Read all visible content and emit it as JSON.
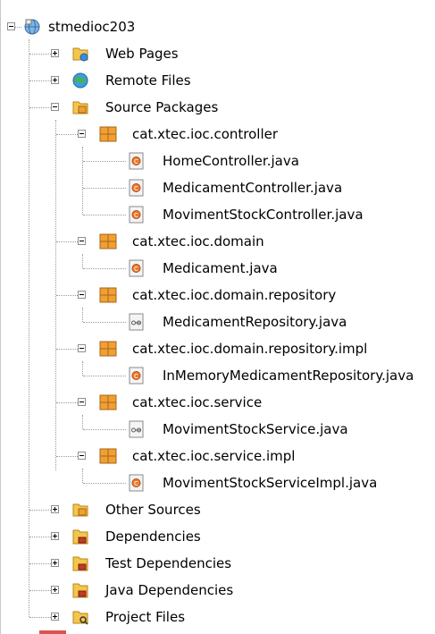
{
  "tree": {
    "root": {
      "label": "stmedioc203",
      "icon": "globe-project-icon",
      "expanded": true
    },
    "nodes": [
      {
        "label": "Web Pages",
        "icon": "web-pages-folder-icon",
        "expanded": false
      },
      {
        "label": "Remote Files",
        "icon": "remote-files-globe-icon",
        "expanded": false
      },
      {
        "label": "Source Packages",
        "icon": "source-folder-icon",
        "expanded": true
      },
      {
        "label": "cat.xtec.ioc.controller",
        "icon": "package-icon",
        "expanded": true
      },
      {
        "label": "HomeController.java",
        "icon": "java-class-icon"
      },
      {
        "label": "MedicamentController.java",
        "icon": "java-class-icon"
      },
      {
        "label": "MovimentStockController.java",
        "icon": "java-class-icon"
      },
      {
        "label": "cat.xtec.ioc.domain",
        "icon": "package-icon",
        "expanded": true
      },
      {
        "label": "Medicament.java",
        "icon": "java-class-icon"
      },
      {
        "label": "cat.xtec.ioc.domain.repository",
        "icon": "package-icon",
        "expanded": true
      },
      {
        "label": "MedicamentRepository.java",
        "icon": "java-interface-icon"
      },
      {
        "label": "cat.xtec.ioc.domain.repository.impl",
        "icon": "package-icon",
        "expanded": true
      },
      {
        "label": "InMemoryMedicamentRepository.java",
        "icon": "java-class-icon"
      },
      {
        "label": "cat.xtec.ioc.service",
        "icon": "package-icon",
        "expanded": true
      },
      {
        "label": "MovimentStockService.java",
        "icon": "java-interface-icon"
      },
      {
        "label": "cat.xtec.ioc.service.impl",
        "icon": "package-icon",
        "expanded": true
      },
      {
        "label": "MovimentStockServiceImpl.java",
        "icon": "java-class-icon"
      },
      {
        "label": "Other Sources",
        "icon": "other-sources-folder-icon",
        "expanded": false
      },
      {
        "label": "Dependencies",
        "icon": "dependencies-folder-icon",
        "expanded": false
      },
      {
        "label": "Test Dependencies",
        "icon": "dependencies-folder-icon",
        "expanded": false
      },
      {
        "label": "Java Dependencies",
        "icon": "dependencies-folder-icon",
        "expanded": false
      },
      {
        "label": "Project Files",
        "icon": "project-files-folder-icon",
        "expanded": false
      }
    ]
  },
  "colors": {
    "folder_yellow": "#f4c64c",
    "package_orange": "#f0a032",
    "tree_line": "#9a9a9a"
  }
}
